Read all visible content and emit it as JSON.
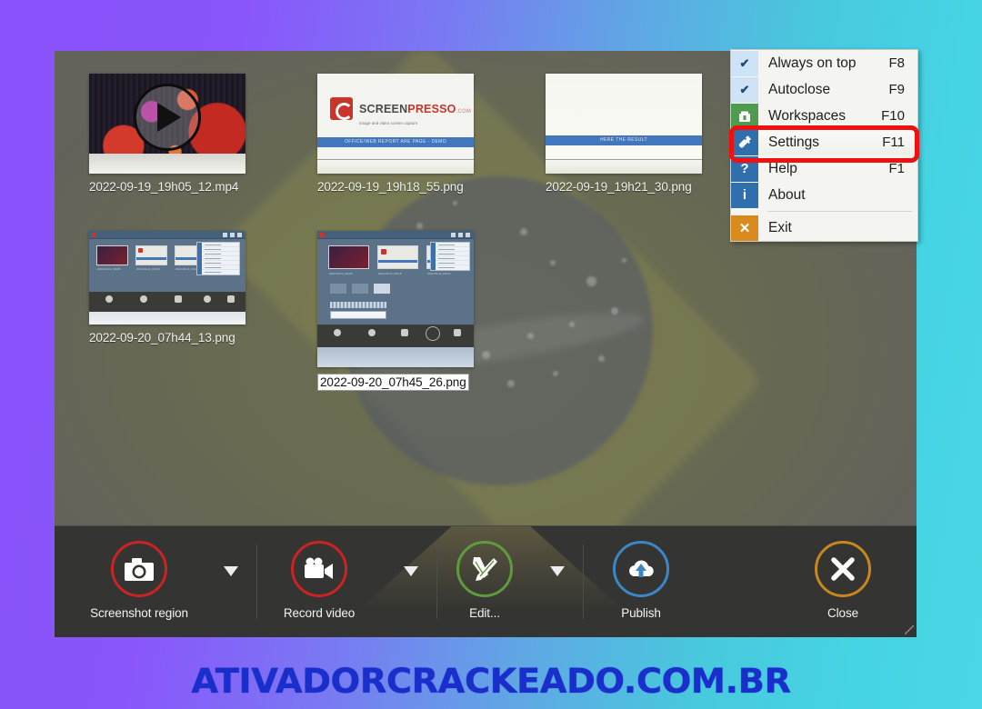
{
  "theme": {
    "bg_gradient_from": "#8a52fb",
    "bg_gradient_to": "#4ad7e6",
    "window_bg": "#63625b",
    "toolbar_bg": "#343432",
    "menu_bg": "#f4f5f0",
    "highlight_outline": "#f01010",
    "accent_red": "#cc2222",
    "accent_green": "#5f9b3c",
    "accent_blue": "#3d86c6",
    "accent_orange": "#c9861f"
  },
  "watermark": {
    "text": "ATIVADORCRACKEADO.COM.BR",
    "color": "#1a2ecb"
  },
  "app": {
    "name": "Screenpresso",
    "thumbnails": [
      {
        "filename": "2022-09-19_19h05_12.mp4",
        "kind": "video",
        "selected": false,
        "overlay_icon": "play-icon"
      },
      {
        "filename": "2022-09-19_19h18_55.png",
        "kind": "document",
        "selected": false,
        "logo_text_a": "SCREEN",
        "logo_text_b": "PRESSO",
        "logo_text_c": ".COM",
        "logo_tagline": "Image and video screen capture",
        "band_text": "OFFICE/WEB REPORT ARE PAGE - DEMO"
      },
      {
        "filename": "2022-09-19_19h21_30.png",
        "kind": "document",
        "selected": false,
        "band_text": "HERE THE RESULT"
      },
      {
        "filename": "2022-09-20_07h44_13.png",
        "kind": "screenshot",
        "selected": false
      },
      {
        "filename": "2022-09-20_07h45_26.png",
        "kind": "screenshot",
        "selected": true
      }
    ],
    "toolbar": {
      "buttons": [
        {
          "label": "Screenshot region",
          "icon": "camera-icon",
          "ring_color": "#cc2222",
          "has_dropdown": true
        },
        {
          "label": "Record video",
          "icon": "video-camera-icon",
          "ring_color": "#cc2222",
          "has_dropdown": true
        },
        {
          "label": "Edit...",
          "icon": "edit-tools-icon",
          "ring_color": "#5f9b3c",
          "has_dropdown": true
        },
        {
          "label": "Publish",
          "icon": "upload-cloud-icon",
          "ring_color": "#3d86c6",
          "has_dropdown": false
        },
        {
          "label": "Close",
          "icon": "close-x-icon",
          "ring_color": "#c9861f",
          "has_dropdown": false
        }
      ]
    }
  },
  "context_menu": {
    "items": [
      {
        "label": "Always on top",
        "shortcut": "F8",
        "icon": "check-icon",
        "icon_style": "check",
        "checked": true,
        "highlighted": false
      },
      {
        "label": "Autoclose",
        "shortcut": "F9",
        "icon": "check-icon",
        "icon_style": "check",
        "checked": true,
        "highlighted": false
      },
      {
        "label": "Workspaces",
        "shortcut": "F10",
        "icon": "workspaces-icon",
        "icon_style": "green",
        "checked": false,
        "highlighted": false
      },
      {
        "label": "Settings",
        "shortcut": "F11",
        "icon": "wrench-icon",
        "icon_style": "bluesq",
        "checked": false,
        "highlighted": true
      },
      {
        "label": "Help",
        "shortcut": "F1",
        "icon": "question-icon",
        "icon_style": "bluesq",
        "checked": false,
        "highlighted": false
      },
      {
        "label": "About",
        "shortcut": "",
        "icon": "info-icon",
        "icon_style": "bluesq",
        "checked": false,
        "highlighted": false
      },
      {
        "label": "Exit",
        "shortcut": "",
        "icon": "exit-x-icon",
        "icon_style": "orange",
        "checked": false,
        "highlighted": false
      }
    ],
    "separator_before_index": 6,
    "highlighted_item": "Settings"
  }
}
